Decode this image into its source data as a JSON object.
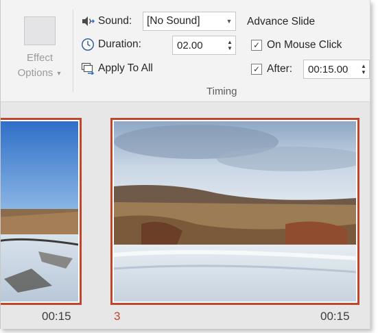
{
  "effect": {
    "label_line1": "Effect",
    "label_line2": "Options"
  },
  "timing": {
    "sound_label": "Sound:",
    "sound_value": "[No Sound]",
    "duration_label": "Duration:",
    "duration_value": "02.00",
    "apply_all_label": "Apply To All",
    "group_label": "Timing"
  },
  "advance": {
    "title": "Advance Slide",
    "on_mouse_click_label": "On Mouse Click",
    "on_mouse_click_checked": true,
    "after_label": "After:",
    "after_checked": true,
    "after_value": "00:15.00"
  },
  "slides": [
    {
      "number": "",
      "time": "00:15"
    },
    {
      "number": "3",
      "time": "00:15"
    }
  ],
  "colors": {
    "accent": "#c0452b",
    "ribbon_bg": "#f3f3f3",
    "sorter_bg": "#e8e7e7"
  },
  "icons": {
    "sound": "speaker-icon",
    "duration": "clock-icon",
    "apply_all": "apply-all-icon"
  }
}
